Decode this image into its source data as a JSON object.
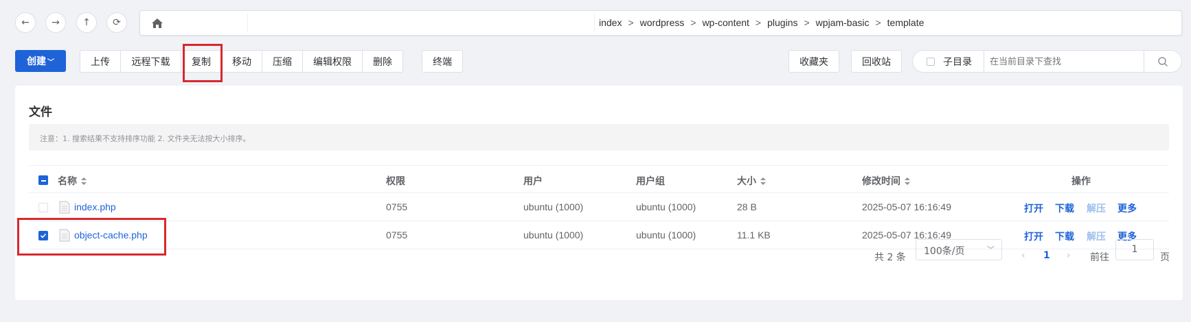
{
  "breadcrumb": [
    "index",
    "wordpress",
    "wp-content",
    "plugins",
    "wpjam-basic",
    "template"
  ],
  "breadcrumb_sep": ">",
  "toolbar": {
    "create": "创建",
    "group1": [
      "上传",
      "远程下载",
      "复制",
      "移动",
      "压缩",
      "编辑权限",
      "删除"
    ],
    "terminal": "终端",
    "favorites": "收藏夹",
    "recycle": "回收站",
    "subdir": "子目录",
    "search_placeholder": "在当前目录下查找"
  },
  "card": {
    "title": "文件",
    "notice": "注意：1. 搜索结果不支持排序功能 2. 文件夹无法按大小排序。"
  },
  "table": {
    "headers": {
      "name": "名称",
      "perm": "权限",
      "user": "用户",
      "group": "用户组",
      "size": "大小",
      "mtime": "修改时间",
      "actions": "操作"
    },
    "rows": [
      {
        "name": "index.php",
        "perm": "0755",
        "user": "ubuntu (1000)",
        "group": "ubuntu (1000)",
        "size": "28 B",
        "mtime": "2025-05-07 16:16:49",
        "checked": false
      },
      {
        "name": "object-cache.php",
        "perm": "0755",
        "user": "ubuntu (1000)",
        "group": "ubuntu (1000)",
        "size": "11.1 KB",
        "mtime": "2025-05-07 16:16:49",
        "checked": true
      }
    ],
    "actions": [
      "打开",
      "下载",
      "解压",
      "更多"
    ]
  },
  "pagination": {
    "total": "共 2 条",
    "page_size": "100条/页",
    "current": "1",
    "goto_label": "前往",
    "goto_value": "1",
    "page_suffix": "页"
  },
  "colors": {
    "primary": "#1e63d8",
    "highlight": "#d7282e"
  }
}
